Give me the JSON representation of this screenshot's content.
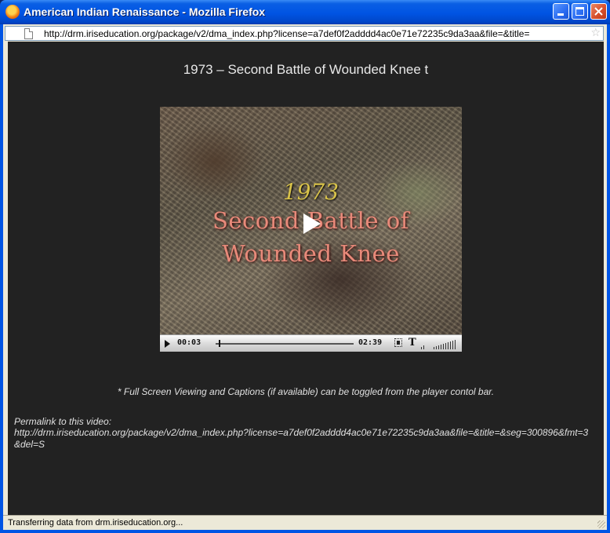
{
  "window": {
    "title": "American Indian Renaissance - Mozilla Firefox"
  },
  "address_bar": {
    "url": "http://drm.iriseducation.org/package/v2/dma_index.php?license=a7def0f2adddd4ac0e71e72235c9da3aa&file=&title="
  },
  "page": {
    "video_title": "1973 – Second Battle of Wounded Knee t",
    "video_frame_text": {
      "year": "1973",
      "line1": "Second Battle of",
      "line2": "Wounded Knee"
    },
    "player": {
      "elapsed": "00:03",
      "duration": "02:39",
      "captions_label": "T",
      "progress_fraction": 0.02
    },
    "note": "* Full Screen Viewing and Captions (if available) can be toggled from the player contol bar.",
    "permalink_label": "Permalink to this video:",
    "permalink_url": "http://drm.iriseducation.org/package/v2/dma_index.php?license=a7def0f2adddd4ac0e71e72235c9da3aa&file=&title=&seg=300896&fmt=3&del=S"
  },
  "status_bar": {
    "text": "Transferring data from drm.iriseducation.org..."
  },
  "icons": [
    "firefox-icon",
    "minimize-icon",
    "maximize-icon",
    "close-icon",
    "page-icon",
    "star-icon",
    "play-icon",
    "fullscreen-icon",
    "volume-icon",
    "resize-grip-icon"
  ]
}
